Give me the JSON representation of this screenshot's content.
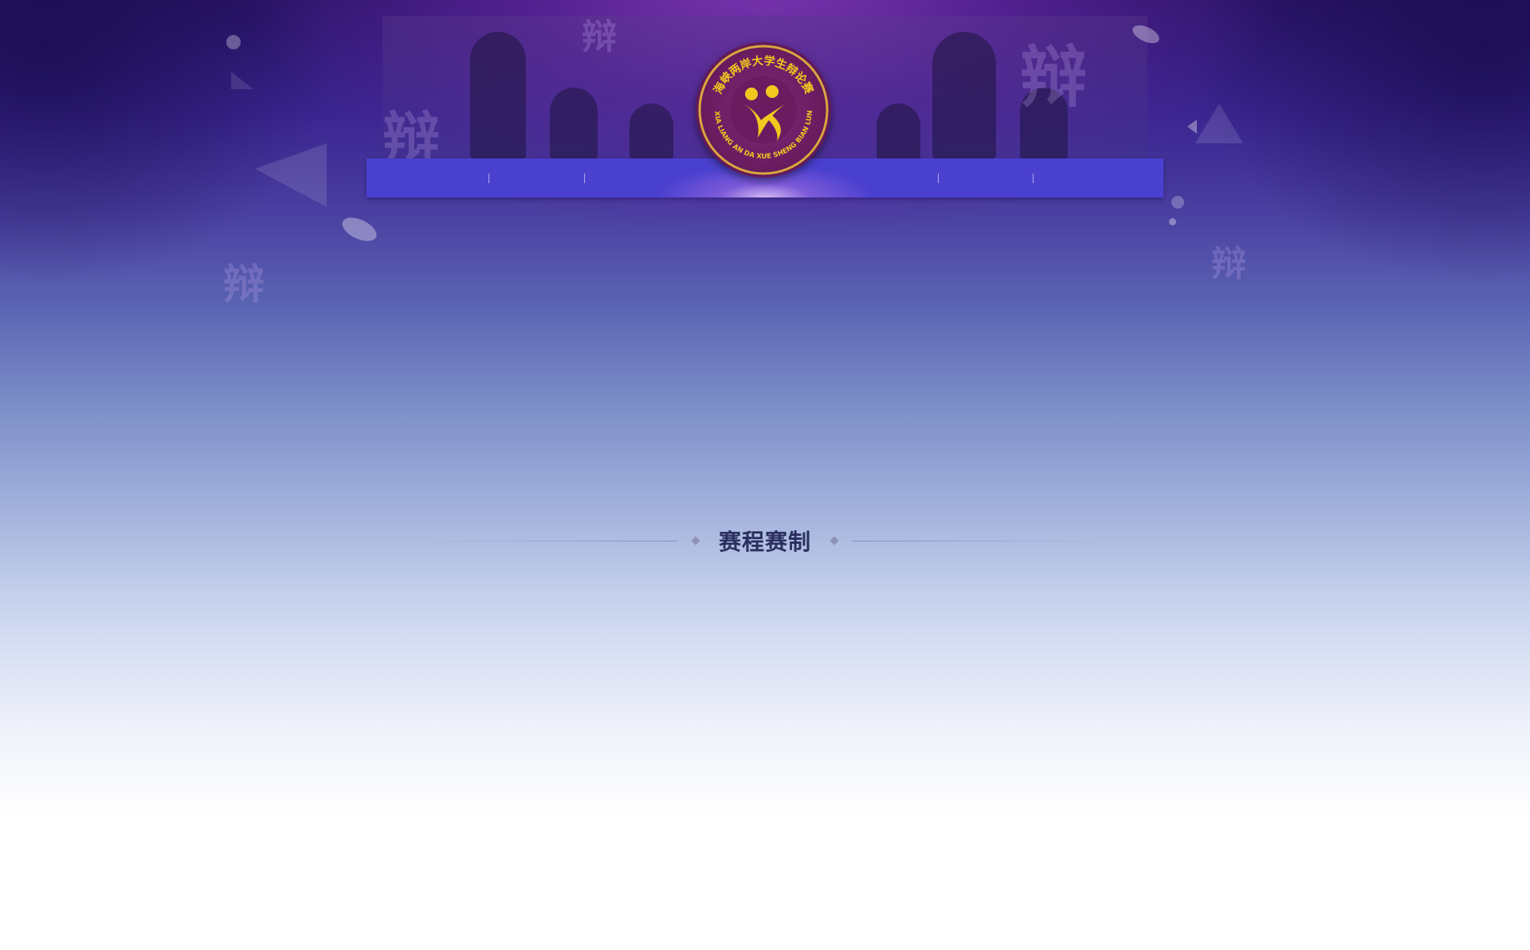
{
  "banner": {
    "watermark_char": "辩",
    "logo": {
      "name_cn": "海峡两岸大学生辩论赛",
      "name_pinyin": "HAI XIA LIANG AN DA XUE SHENG BIAN LUN SAI"
    }
  },
  "navbar": {
    "items": [
      {
        "label": ""
      },
      {
        "label": ""
      },
      {
        "label": ""
      },
      {
        "label": ""
      },
      {
        "label": ""
      },
      {
        "label": ""
      }
    ]
  },
  "section": {
    "title": "赛程赛制"
  },
  "colors": {
    "nav_bg": "#4a40cf",
    "title_text": "#2a2f5e",
    "logo_gold": "#f2c81e",
    "logo_ring": "#6a1c60"
  }
}
